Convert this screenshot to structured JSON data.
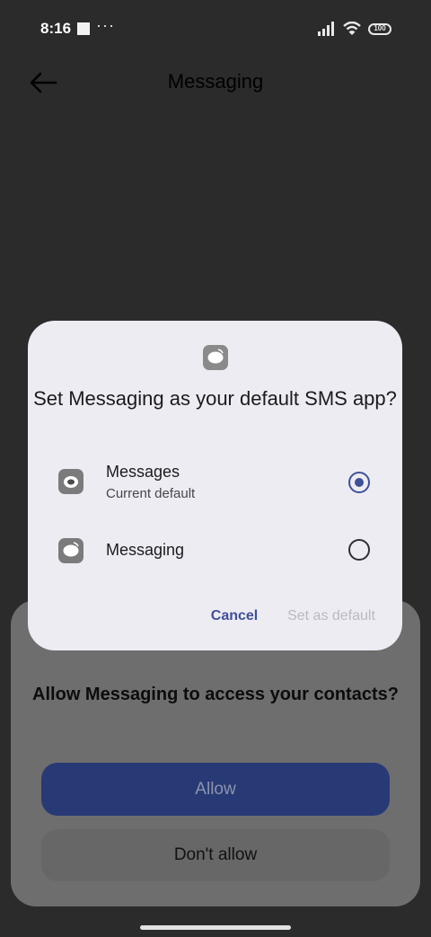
{
  "status_bar": {
    "time": "8:16",
    "overflow": "···",
    "battery": "100",
    "icons": [
      "signal-icon",
      "wifi-icon",
      "battery-icon"
    ]
  },
  "top_bar": {
    "title": "Messaging",
    "back_icon": "back-arrow-icon"
  },
  "default_sms_dialog": {
    "app_icon": "messaging-app-icon",
    "title": "Set Messaging as your default SMS app?",
    "options": [
      {
        "label": "Messages",
        "subtitle": "Current default",
        "selected": true,
        "icon": "messages-app-icon"
      },
      {
        "label": "Messaging",
        "subtitle": "",
        "selected": false,
        "icon": "messaging-app-icon"
      }
    ],
    "cancel_label": "Cancel",
    "set_default_label": "Set as default"
  },
  "permission_sheet": {
    "icon": "contacts-icon",
    "title": "Allow Messaging to access your contacts?",
    "allow_label": "Allow",
    "deny_label": "Don't allow"
  },
  "colors": {
    "accent": "#3d5199",
    "dialog_background": "#eeecf3",
    "scrim": "#2b2b2b"
  }
}
